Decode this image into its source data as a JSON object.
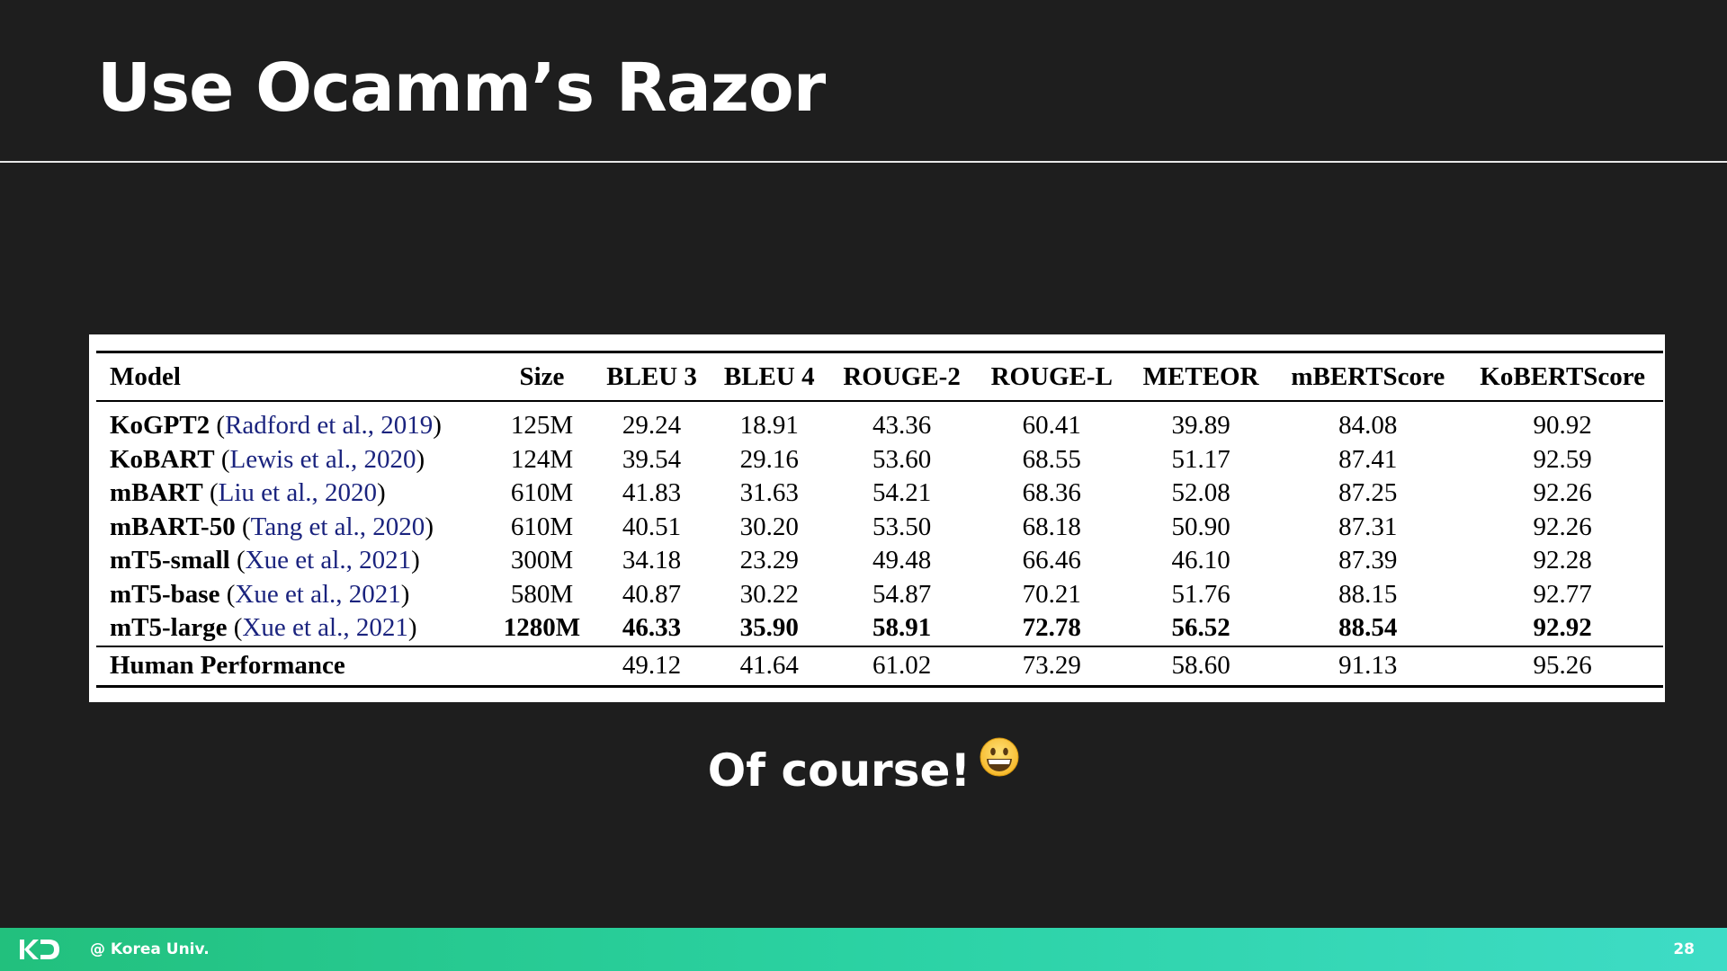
{
  "slide": {
    "title": "Use Ocamm’s Razor",
    "subtitle": "Of course!",
    "emoji": "grinning-face"
  },
  "table": {
    "headers": [
      "Model",
      "Size",
      "BLEU 3",
      "BLEU 4",
      "ROUGE-2",
      "ROUGE-L",
      "METEOR",
      "mBERTScore",
      "KoBERTScore"
    ],
    "rows": [
      {
        "model": "KoGPT2",
        "citation": "Radford et al., 2019",
        "size": "125M",
        "bleu3": "29.24",
        "bleu4": "18.91",
        "rouge2": "43.36",
        "rougel": "60.41",
        "meteor": "39.89",
        "mbertscore": "84.08",
        "kobertscore": "90.92"
      },
      {
        "model": "KoBART",
        "citation": "Lewis et al., 2020",
        "size": "124M",
        "bleu3": "39.54",
        "bleu4": "29.16",
        "rouge2": "53.60",
        "rougel": "68.55",
        "meteor": "51.17",
        "mbertscore": "87.41",
        "kobertscore": "92.59"
      },
      {
        "model": "mBART",
        "citation": "Liu et al., 2020",
        "size": "610M",
        "bleu3": "41.83",
        "bleu4": "31.63",
        "rouge2": "54.21",
        "rougel": "68.36",
        "meteor": "52.08",
        "mbertscore": "87.25",
        "kobertscore": "92.26"
      },
      {
        "model": "mBART-50",
        "citation": "Tang et al., 2020",
        "size": "610M",
        "bleu3": "40.51",
        "bleu4": "30.20",
        "rouge2": "53.50",
        "rougel": "68.18",
        "meteor": "50.90",
        "mbertscore": "87.31",
        "kobertscore": "92.26"
      },
      {
        "model": "mT5-small",
        "citation": "Xue et al., 2021",
        "size": "300M",
        "bleu3": "34.18",
        "bleu4": "23.29",
        "rouge2": "49.48",
        "rougel": "66.46",
        "meteor": "46.10",
        "mbertscore": "87.39",
        "kobertscore": "92.28"
      },
      {
        "model": "mT5-base",
        "citation": "Xue et al., 2021",
        "size": "580M",
        "bleu3": "40.87",
        "bleu4": "30.22",
        "rouge2": "54.87",
        "rougel": "70.21",
        "meteor": "51.76",
        "mbertscore": "88.15",
        "kobertscore": "92.77"
      },
      {
        "model": "mT5-large",
        "citation": "Xue et al., 2021",
        "size": "1280M",
        "bleu3": "46.33",
        "bleu4": "35.90",
        "rouge2": "58.91",
        "rougel": "72.78",
        "meteor": "56.52",
        "mbertscore": "88.54",
        "kobertscore": "92.92"
      }
    ],
    "human": {
      "label": "Human Performance",
      "size": "",
      "bleu3": "49.12",
      "bleu4": "41.64",
      "rouge2": "61.02",
      "rougel": "73.29",
      "meteor": "58.60",
      "mbertscore": "91.13",
      "kobertscore": "95.26"
    }
  },
  "footer": {
    "logo": "KU-logo-icon",
    "text": "@ Korea Univ.",
    "page": "28",
    "accent_start": "#22c07d",
    "accent_end": "#3edcc6"
  }
}
